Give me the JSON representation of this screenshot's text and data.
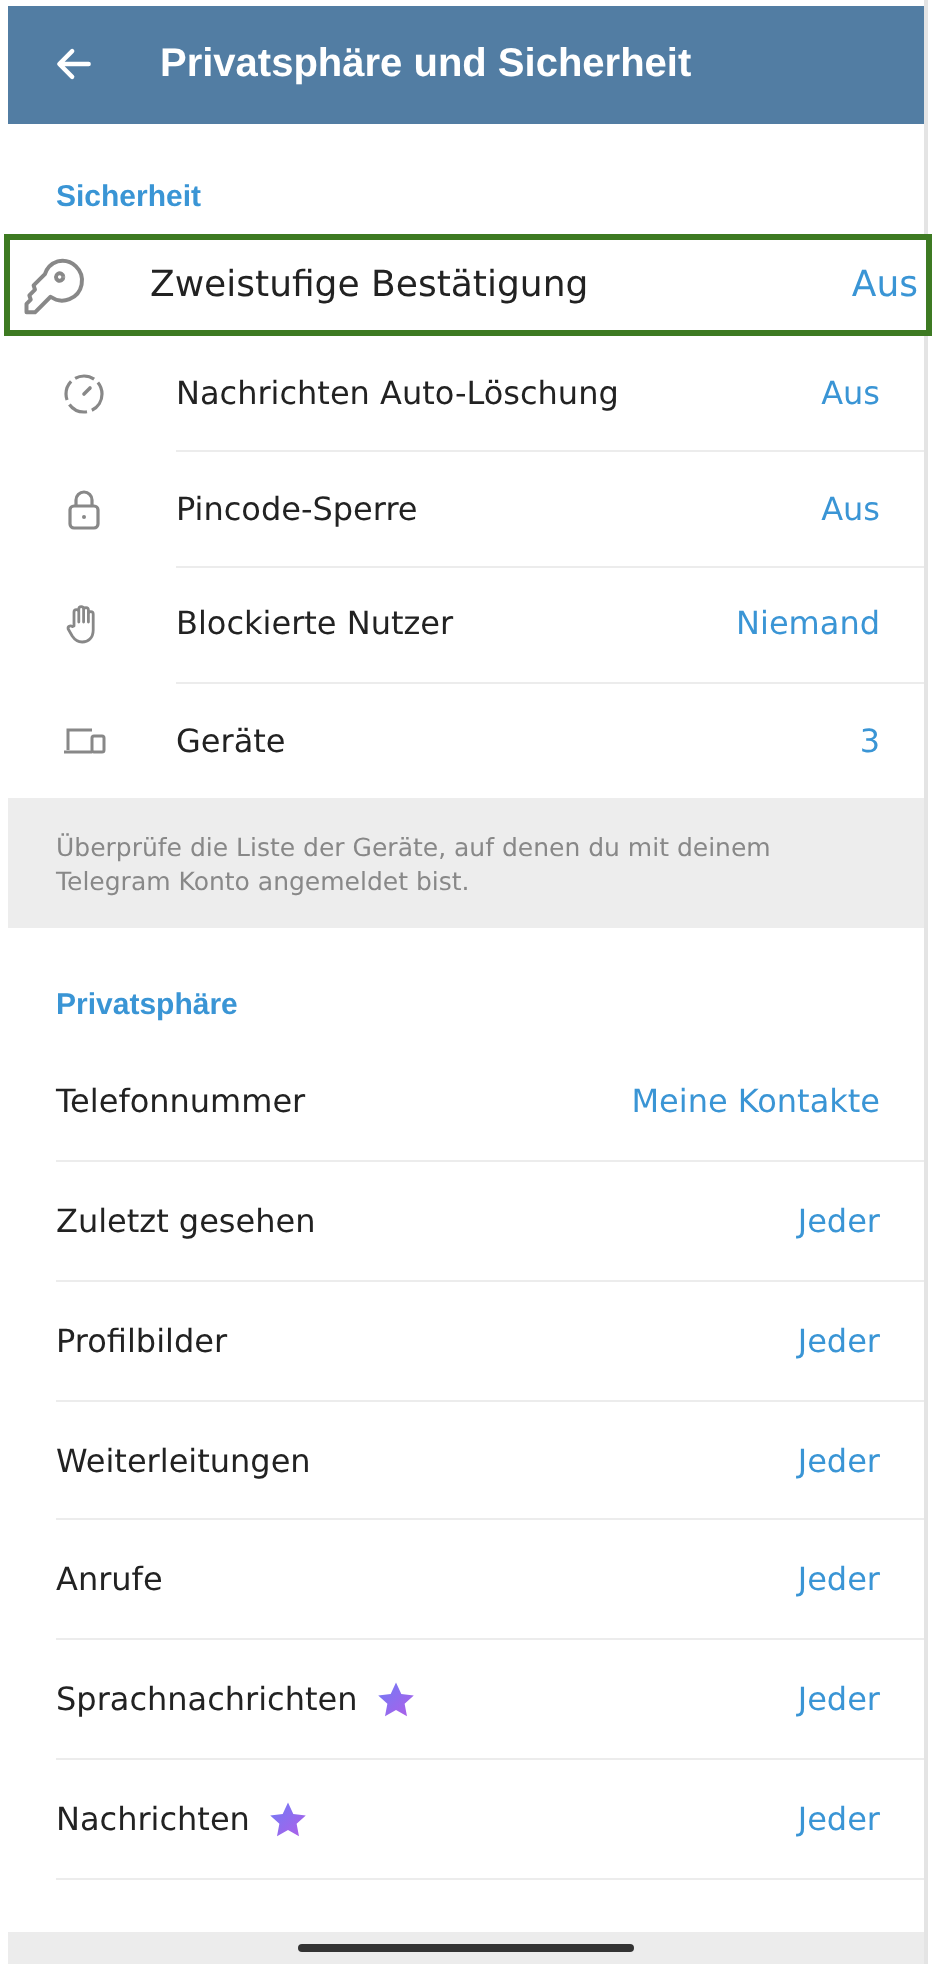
{
  "header": {
    "title": "Privatsphäre und Sicherheit"
  },
  "security": {
    "heading": "Sicherheit",
    "items": [
      {
        "label": "Zweistufige Bestätigung",
        "value": "Aus",
        "highlighted": true
      },
      {
        "label": "Nachrichten Auto-Löschung",
        "value": "Aus",
        "highlighted": false
      },
      {
        "label": "Pincode-Sperre",
        "value": "Aus",
        "highlighted": false
      },
      {
        "label": "Blockierte Nutzer",
        "value": "Niemand",
        "highlighted": false
      },
      {
        "label": "Geräte",
        "value": "3",
        "highlighted": false
      }
    ],
    "info": "Überprüfe die Liste der Geräte, auf denen du mit deinem Telegram Konto angemeldet bist."
  },
  "privacy": {
    "heading": "Privatsphäre",
    "items": [
      {
        "label": "Telefonnummer",
        "value": "Meine Kontakte",
        "premium": false
      },
      {
        "label": "Zuletzt gesehen",
        "value": "Jeder",
        "premium": false
      },
      {
        "label": "Profilbilder",
        "value": "Jeder",
        "premium": false
      },
      {
        "label": "Weiterleitungen",
        "value": "Jeder",
        "premium": false
      },
      {
        "label": "Anrufe",
        "value": "Jeder",
        "premium": false
      },
      {
        "label": "Sprachnachrichten",
        "value": "Jeder",
        "premium": true
      },
      {
        "label": "Nachrichten",
        "value": "Jeder",
        "premium": true
      }
    ]
  }
}
